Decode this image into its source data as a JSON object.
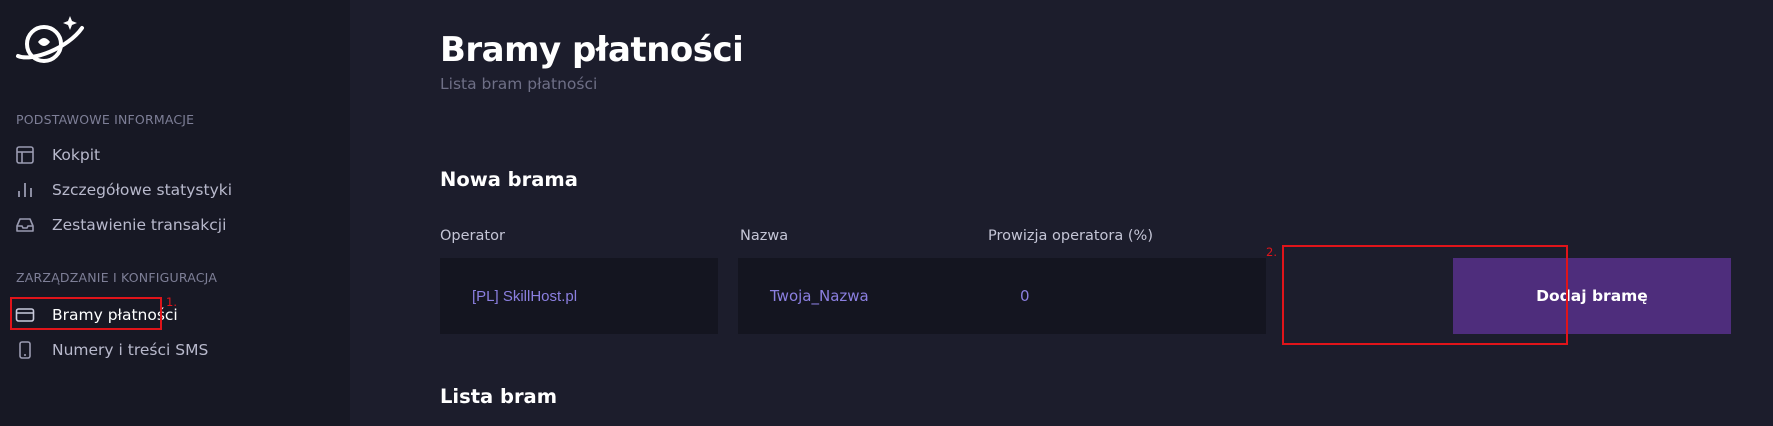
{
  "sidebar": {
    "section1": "PODSTAWOWE INFORMACJE",
    "items1": [
      {
        "label": "Kokpit",
        "icon": "layout-icon"
      },
      {
        "label": "Szczegółowe statystyki",
        "icon": "bar-chart-icon"
      },
      {
        "label": "Zestawienie transakcji",
        "icon": "inbox-icon"
      }
    ],
    "section2": "ZARZĄDZANIE I KONFIGURACJA",
    "items2": [
      {
        "label": "Bramy płatności",
        "icon": "credit-card-icon",
        "active": true
      },
      {
        "label": "Numery i treści SMS",
        "icon": "smartphone-icon"
      }
    ]
  },
  "annotations": {
    "step1": "1.",
    "step2": "2."
  },
  "page": {
    "title": "Bramy płatności",
    "subtitle": "Lista bram płatności"
  },
  "new_gateway": {
    "heading": "Nowa brama",
    "operator_label": "Operator",
    "operator_value": "[PL] SkillHost.pl",
    "name_label": "Nazwa",
    "name_value": "Twoja_Nazwa",
    "fee_label": "Prowizja operatora (%)",
    "fee_value": "0",
    "add_button": "Dodaj bramę"
  },
  "list": {
    "heading": "Lista bram"
  },
  "colors": {
    "accent": "#4e2d7c",
    "highlight": "#e0141a",
    "input_text": "#8b7fe0"
  }
}
